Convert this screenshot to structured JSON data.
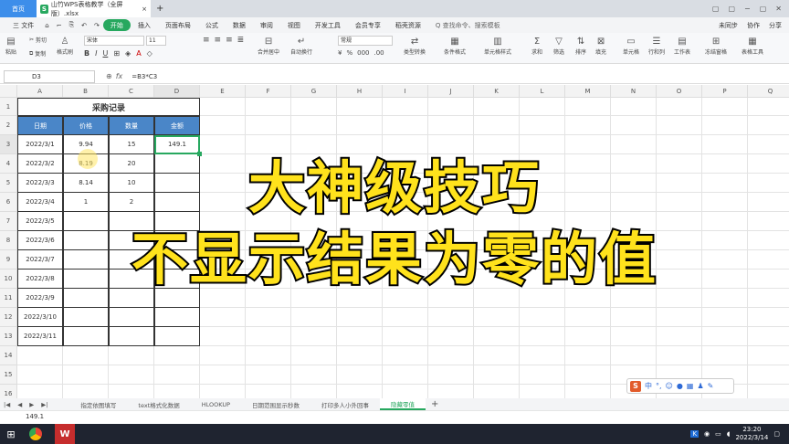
{
  "titlebar": {
    "home": "首页",
    "file_name": "山竹WPS表格教学（全屏版）.xlsx",
    "right": [
      "▢",
      "▢",
      "−",
      "▢",
      "✕"
    ]
  },
  "menubar": {
    "items": [
      "三 文件",
      "⌂",
      "⌐",
      "⎘",
      "↶",
      "↷",
      "开始",
      "插入",
      "页面布局",
      "公式",
      "数据",
      "审阅",
      "视图",
      "开发工具",
      "会员专享",
      "稻壳资源",
      "Q 查找命令、搜索模板"
    ],
    "right": [
      "未同步",
      "协作",
      "分享"
    ]
  },
  "ribbon": {
    "buttons": [
      "粘贴",
      "剪切",
      "复制",
      "格式刷",
      "合并居中",
      "自动换行",
      "类型转换",
      "条件格式",
      "单元格样式",
      "求和",
      "筛选",
      "排序",
      "填充",
      "单元格",
      "行和列",
      "工作表",
      "冻结窗格",
      "表格工具"
    ],
    "font": "宋体",
    "size": "11",
    "format": "常规"
  },
  "formulabar": {
    "name": "D3",
    "fx": "fx",
    "formula": "=B3*C3"
  },
  "columns": [
    "A",
    "B",
    "C",
    "D",
    "E",
    "F",
    "G",
    "H",
    "I",
    "J",
    "K",
    "L",
    "M",
    "N",
    "O",
    "P",
    "Q"
  ],
  "rows": [
    "1",
    "2",
    "3",
    "4",
    "5",
    "6",
    "7",
    "8",
    "9",
    "10",
    "11",
    "12",
    "13",
    "14",
    "15",
    "16"
  ],
  "table": {
    "title": "采购记录",
    "headers": [
      "日期",
      "价格",
      "数量",
      "金额"
    ],
    "data": [
      [
        "2022/3/1",
        "9.94",
        "15",
        "149.1"
      ],
      [
        "2022/3/2",
        "8.19",
        "20",
        ""
      ],
      [
        "2022/3/3",
        "8.14",
        "10",
        ""
      ],
      [
        "2022/3/4",
        "1",
        "2",
        ""
      ],
      [
        "2022/3/5",
        "",
        "",
        ""
      ],
      [
        "2022/3/6",
        "",
        "",
        ""
      ],
      [
        "2022/3/7",
        "",
        "",
        ""
      ],
      [
        "2022/3/8",
        "",
        "",
        ""
      ],
      [
        "2022/3/9",
        "",
        "",
        ""
      ],
      [
        "2022/3/10",
        "",
        "",
        ""
      ],
      [
        "2022/3/11",
        "",
        "",
        ""
      ]
    ]
  },
  "overlay": {
    "line1": "大神级技巧",
    "line2": "不显示结果为零的值"
  },
  "sheets": [
    "指定依图填写",
    "text格式化数据",
    "HLOOKUP",
    "日期范围显示秒数",
    "打印多人小外回事",
    "隐藏零值"
  ],
  "active_sheet": "隐藏零值",
  "status": {
    "value": "149.1"
  },
  "ime": {
    "label": "中"
  },
  "taskbar": {
    "time": "23:20",
    "date": "2022/3/14"
  },
  "colors": {
    "header_fill": "#4a86c8",
    "accent": "#27a85f",
    "overlay_text": "#ffe21c"
  }
}
